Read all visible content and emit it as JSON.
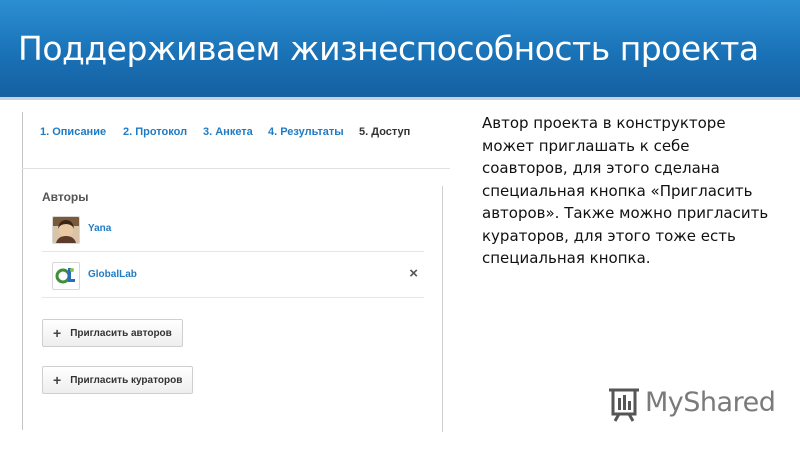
{
  "slide": {
    "title": "Поддерживаем жизнеспособность проекта",
    "description": "Автор проекта в конструкторе может приглашать к себе соавторов, для этого сделана специальная кнопка «Пригласить авторов». Также можно пригласить кураторов, для этого тоже есть специальная кнопка.",
    "header_color": "#1a72b7"
  },
  "screenshot": {
    "tabs": [
      "1. Описание",
      "2. Протокол",
      "3. Анкета",
      "4. Результаты",
      "5. Доступ"
    ],
    "active_tab_index": 4,
    "authors_label": "Авторы",
    "authors": [
      {
        "name": "Yana",
        "avatar": "photo"
      },
      {
        "name": "GlobalLab",
        "avatar": "globallab-logo",
        "remove": "×"
      }
    ],
    "invite_authors_label": "Пригласить авторов",
    "invite_curators_label": "Пригласить кураторов",
    "link_color": "#1f7bc4"
  },
  "logo": {
    "text": "MyShared",
    "icon": "myshared-logo-icon"
  }
}
